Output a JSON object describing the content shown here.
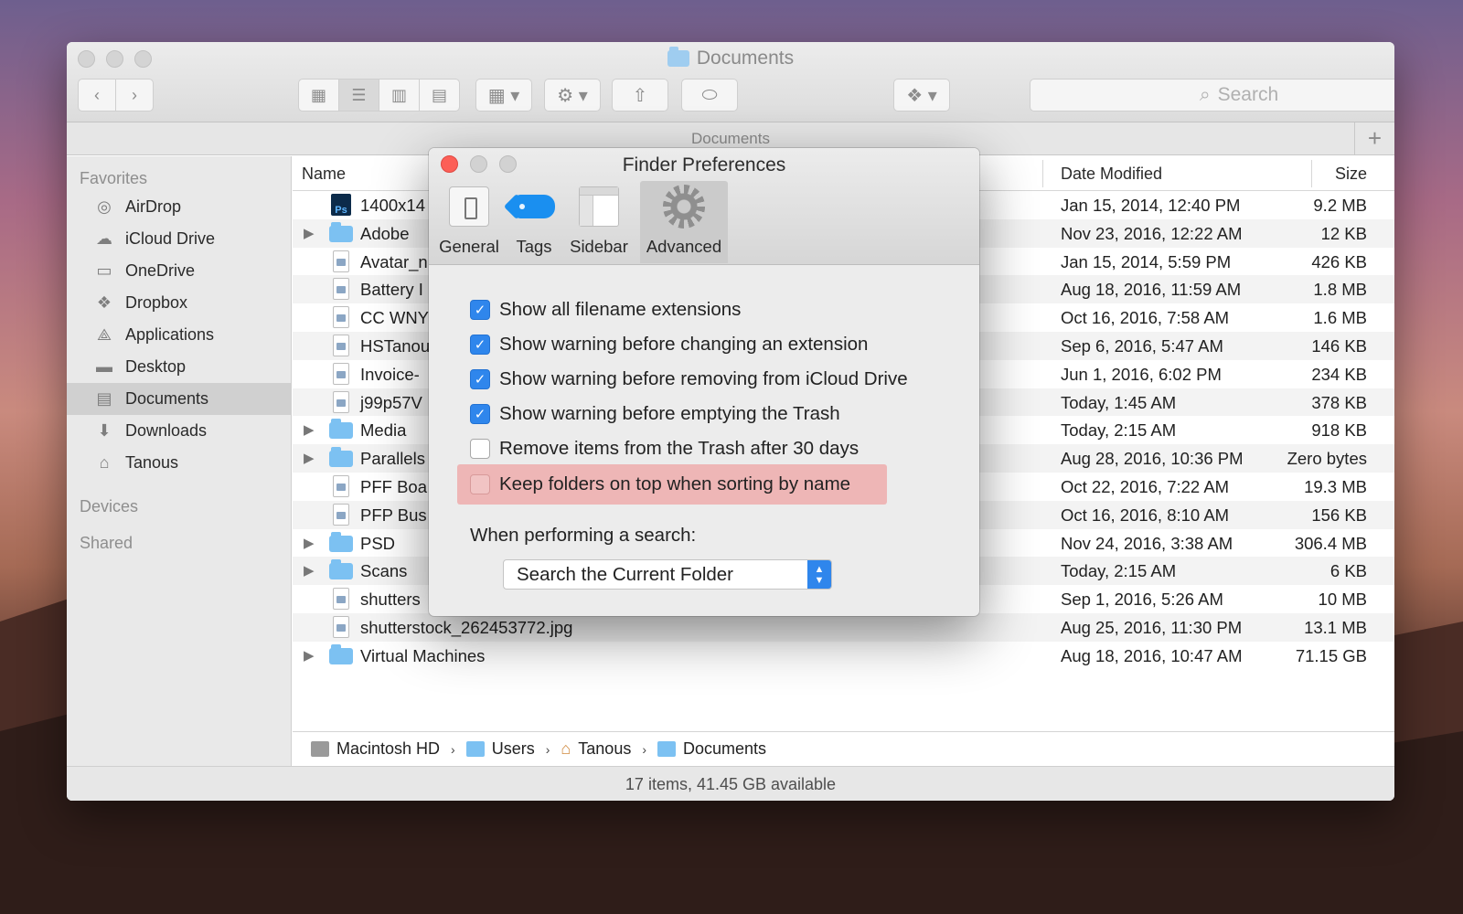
{
  "window": {
    "title": "Documents",
    "path_title": "Documents",
    "search_placeholder": "Search",
    "status": "17 items, 41.45 GB available"
  },
  "sidebar": {
    "favorites_heading": "Favorites",
    "items": [
      {
        "label": "AirDrop",
        "icon": "airdrop-icon"
      },
      {
        "label": "iCloud Drive",
        "icon": "cloud-icon"
      },
      {
        "label": "OneDrive",
        "icon": "folder-icon"
      },
      {
        "label": "Dropbox",
        "icon": "dropbox-icon"
      },
      {
        "label": "Applications",
        "icon": "applications-icon"
      },
      {
        "label": "Desktop",
        "icon": "desktop-icon"
      },
      {
        "label": "Documents",
        "icon": "documents-icon",
        "selected": true
      },
      {
        "label": "Downloads",
        "icon": "downloads-icon"
      },
      {
        "label": "Tanous",
        "icon": "home-icon"
      }
    ],
    "devices_heading": "Devices",
    "shared_heading": "Shared"
  },
  "columns": {
    "name": "Name",
    "date": "Date Modified",
    "size": "Size"
  },
  "files": [
    {
      "name": "1400x14",
      "date": "Jan 15, 2014, 12:40 PM",
      "size": "9.2 MB",
      "kind": "ps",
      "folder": false
    },
    {
      "name": "Adobe",
      "date": "Nov 23, 2016, 12:22 AM",
      "size": "12 KB",
      "kind": "folder",
      "folder": true
    },
    {
      "name": "Avatar_n",
      "date": "Jan 15, 2014, 5:59 PM",
      "size": "426 KB",
      "kind": "doc",
      "folder": false
    },
    {
      "name": "Battery I",
      "date": "Aug 18, 2016, 11:59 AM",
      "size": "1.8 MB",
      "kind": "doc",
      "folder": false
    },
    {
      "name": "CC WNY",
      "date": "Oct 16, 2016, 7:58 AM",
      "size": "1.6 MB",
      "kind": "doc",
      "folder": false
    },
    {
      "name": "HSTanou",
      "date": "Sep 6, 2016, 5:47 AM",
      "size": "146 KB",
      "kind": "doc",
      "folder": false
    },
    {
      "name": "Invoice-",
      "date": "Jun 1, 2016, 6:02 PM",
      "size": "234 KB",
      "kind": "doc",
      "folder": false
    },
    {
      "name": "j99p57V",
      "date": "Today, 1:45 AM",
      "size": "378 KB",
      "kind": "doc",
      "folder": false
    },
    {
      "name": "Media",
      "date": "Today, 2:15 AM",
      "size": "918 KB",
      "kind": "folder",
      "folder": true
    },
    {
      "name": "Parallels",
      "date": "Aug 28, 2016, 10:36 PM",
      "size": "Zero bytes",
      "kind": "folder",
      "folder": true
    },
    {
      "name": "PFF Boa",
      "date": "Oct 22, 2016, 7:22 AM",
      "size": "19.3 MB",
      "kind": "doc",
      "folder": false
    },
    {
      "name": "PFP Bus",
      "date": "Oct 16, 2016, 8:10 AM",
      "size": "156 KB",
      "kind": "doc",
      "folder": false
    },
    {
      "name": "PSD",
      "date": "Nov 24, 2016, 3:38 AM",
      "size": "306.4 MB",
      "kind": "folder",
      "folder": true
    },
    {
      "name": "Scans",
      "date": "Today, 2:15 AM",
      "size": "6 KB",
      "kind": "folder",
      "folder": true
    },
    {
      "name": "shutters",
      "date": "Sep 1, 2016, 5:26 AM",
      "size": "10 MB",
      "kind": "doc",
      "folder": false
    },
    {
      "name": "shutterstock_262453772.jpg",
      "date": "Aug 25, 2016, 11:30 PM",
      "size": "13.1 MB",
      "kind": "doc",
      "folder": false
    },
    {
      "name": "Virtual Machines",
      "date": "Aug 18, 2016, 10:47 AM",
      "size": "71.15 GB",
      "kind": "folder",
      "folder": true
    }
  ],
  "path_bar": [
    "Macintosh HD",
    "Users",
    "Tanous",
    "Documents"
  ],
  "prefs": {
    "title": "Finder Preferences",
    "tabs": [
      "General",
      "Tags",
      "Sidebar",
      "Advanced"
    ],
    "active_tab": "Advanced",
    "options": [
      {
        "label": "Show all filename extensions",
        "checked": true
      },
      {
        "label": "Show warning before changing an extension",
        "checked": true
      },
      {
        "label": "Show warning before removing from iCloud Drive",
        "checked": true
      },
      {
        "label": "Show warning before emptying the Trash",
        "checked": true
      },
      {
        "label": "Remove items from the Trash after 30 days",
        "checked": false
      },
      {
        "label": "Keep folders on top when sorting by name",
        "checked": false,
        "highlighted": true
      }
    ],
    "search_label": "When performing a search:",
    "search_scope": "Search the Current Folder"
  },
  "colors": {
    "accent": "#2f86ec",
    "highlight": "#eeb6b6",
    "close": "#fc5f57",
    "folder": "#7cc1f2"
  }
}
